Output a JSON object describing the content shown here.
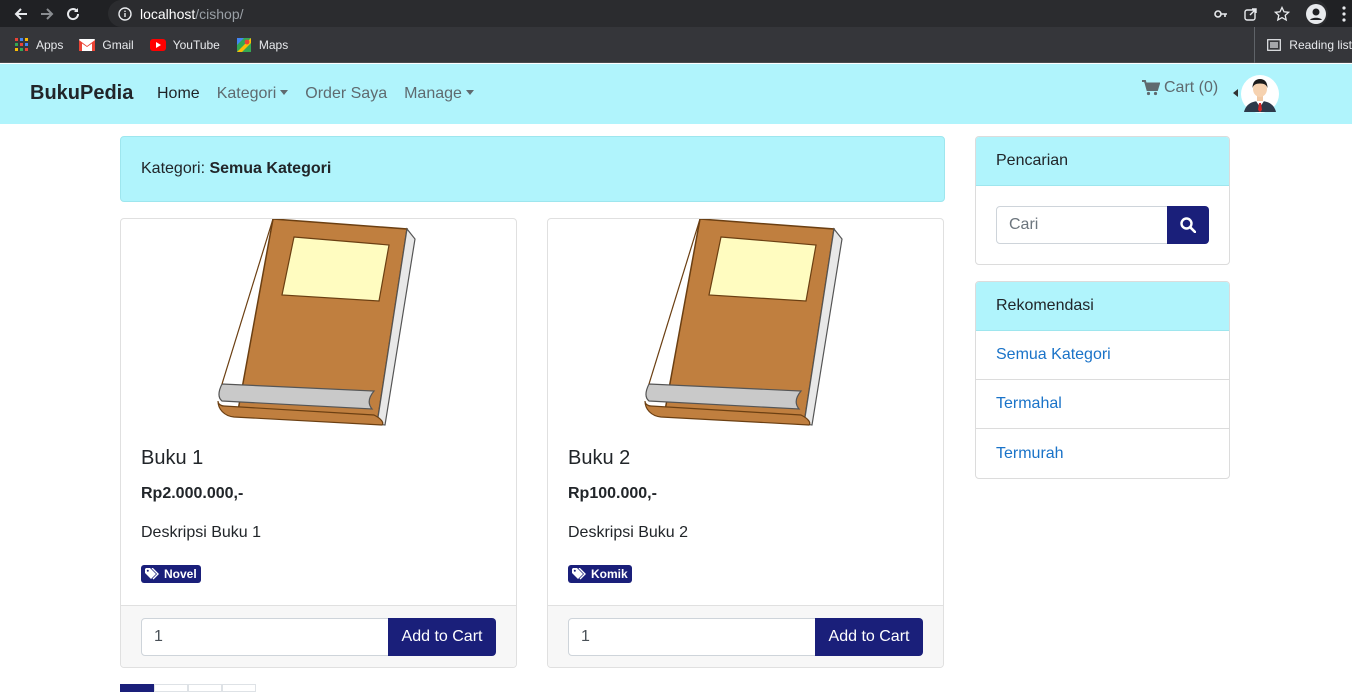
{
  "browser": {
    "url_host": "localhost",
    "url_path": "/cishop/",
    "bookmarks": [
      {
        "label": "Apps",
        "icon": "apps-grid-icon"
      },
      {
        "label": "Gmail",
        "icon": "gmail-icon"
      },
      {
        "label": "YouTube",
        "icon": "youtube-icon"
      },
      {
        "label": "Maps",
        "icon": "maps-icon"
      }
    ],
    "reading_list": "Reading list"
  },
  "navbar": {
    "brand": "BukuPedia",
    "links": {
      "home": "Home",
      "kategori": "Kategori",
      "order": "Order Saya",
      "manage": "Manage"
    },
    "cart": "Cart (0)"
  },
  "kategori_bar": {
    "prefix": "Kategori: ",
    "value": "Semua Kategori"
  },
  "products": [
    {
      "title": "Buku 1",
      "price": "Rp2.000.000,-",
      "description": "Deskripsi Buku 1",
      "tag": "Novel",
      "qty": "1",
      "button": "Add to Cart"
    },
    {
      "title": "Buku 2",
      "price": "Rp100.000,-",
      "description": "Deskripsi Buku 2",
      "tag": "Komik",
      "qty": "1",
      "button": "Add to Cart"
    }
  ],
  "sidebar": {
    "search": {
      "title": "Pencarian",
      "placeholder": "Cari"
    },
    "rekomendasi": {
      "title": "Rekomendasi",
      "items": [
        "Semua Kategori",
        "Termahal",
        "Termurah"
      ]
    }
  },
  "colors": {
    "accent": "#1a1f7a",
    "navbar": "#b0f4fc",
    "link": "#1a73c8"
  }
}
